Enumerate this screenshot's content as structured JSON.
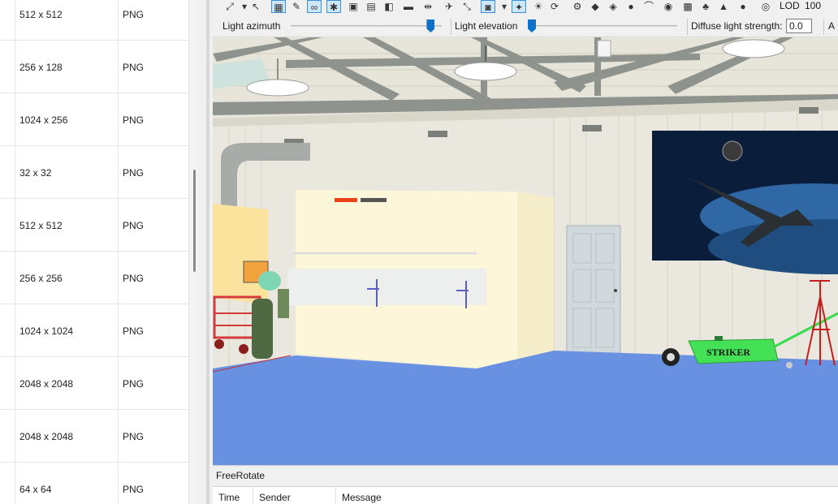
{
  "texture_table": {
    "rows": [
      {
        "dimensions": "512 x 512",
        "format": "PNG"
      },
      {
        "dimensions": "256 x 128",
        "format": "PNG"
      },
      {
        "dimensions": "1024 x 256",
        "format": "PNG"
      },
      {
        "dimensions": "32 x 32",
        "format": "PNG"
      },
      {
        "dimensions": "512 x 512",
        "format": "PNG"
      },
      {
        "dimensions": "256 x 256",
        "format": "PNG"
      },
      {
        "dimensions": "1024 x 1024",
        "format": "PNG"
      },
      {
        "dimensions": "2048 x 2048",
        "format": "PNG"
      },
      {
        "dimensions": "2048 x 2048",
        "format": "PNG"
      },
      {
        "dimensions": "64 x 64",
        "format": "PNG"
      }
    ]
  },
  "toolbar": {
    "lod_label": "LOD",
    "lod_value": "100",
    "icons": [
      "zoom-extents-icon",
      "dropdown-arrow-icon",
      "select-arrow-icon",
      "grid-icon",
      "measure-icon",
      "link-icon",
      "bones-icon",
      "box-icon",
      "texture-icon",
      "material-icon",
      "green-surface-icon",
      "ruler-icon",
      "airplane-icon",
      "scale-icon",
      "camera-icon",
      "dropdown-arrow-icon",
      "light-icon",
      "bulb-icon",
      "refresh-icon",
      "gear-icon",
      "cube-icon",
      "mesh-icon",
      "sphere-icon",
      "curve-icon",
      "ball-icon",
      "checker-icon",
      "tree-icon",
      "cone-icon",
      "apple-icon",
      "eye-icon"
    ]
  },
  "lightbar": {
    "azimuth_label": "Light azimuth",
    "elevation_label": "Light elevation",
    "diffuse_label": "Diffuse light strength:",
    "diffuse_value": "0.0",
    "truncated_label": "A",
    "azimuth_level": 0.9,
    "elevation_level": 0.0
  },
  "viewport": {
    "cart_label": "STRIKER"
  },
  "output": {
    "title": "FreeRotate",
    "columns": [
      "Time",
      "Sender",
      "Message"
    ]
  },
  "colors": {
    "floor": "#6891e2",
    "selection_accent": "#0c71c7",
    "wall": "#e9e7de"
  }
}
